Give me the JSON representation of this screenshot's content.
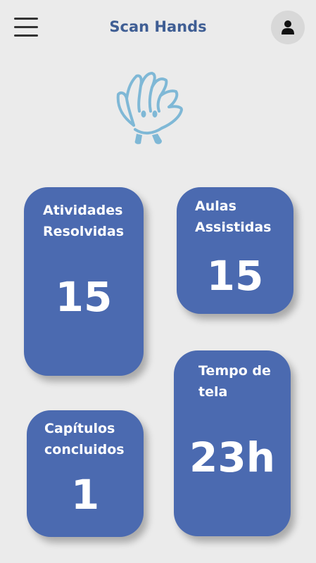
{
  "header": {
    "title": "Scan Hands",
    "menu_icon": "hamburger-menu-icon",
    "profile_icon": "user-icon"
  },
  "mascot": {
    "icon": "hand-mascot-icon",
    "color": "#7fb8d6"
  },
  "stats": {
    "atividades": {
      "label": "Atividades\nResolvidas",
      "value": "15"
    },
    "aulas": {
      "label": "Aulas\nAssistidas",
      "value": "15"
    },
    "tempo": {
      "label": "Tempo de\ntela",
      "value": "23h"
    },
    "capitulos": {
      "label": "Capítulos\nconcluidos",
      "value": "1"
    }
  },
  "colors": {
    "card": "#4b6ab0",
    "title": "#3f5e94",
    "background": "#ebebeb"
  }
}
